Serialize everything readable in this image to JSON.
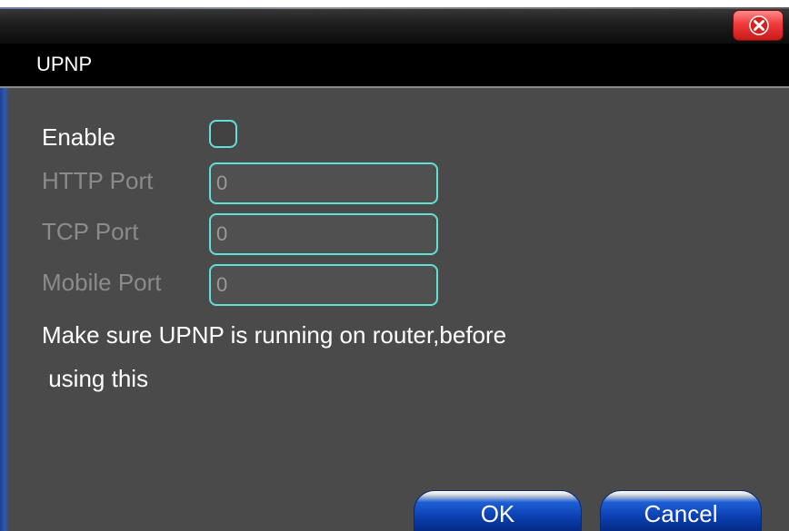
{
  "dialog": {
    "title": "UPNP",
    "close_icon": "close-icon"
  },
  "enable": {
    "label": "Enable",
    "checked": false
  },
  "fields": {
    "http_port": {
      "label": "HTTP Port",
      "value": "0"
    },
    "tcp_port": {
      "label": "TCP Port",
      "value": "0"
    },
    "mobile_port": {
      "label": "Mobile Port",
      "value": "0"
    }
  },
  "message": {
    "line1": "Make sure UPNP is running on router,before",
    "line2": " using this"
  },
  "buttons": {
    "ok_label": "OK",
    "cancel_label": "Cancel"
  },
  "colors": {
    "panel_bg": "#4a4a4a",
    "field_border": "#63e0d6",
    "disabled_text": "#8b8b8b",
    "button_blue": "#1e5fd6",
    "close_red": "#f03b3b"
  }
}
